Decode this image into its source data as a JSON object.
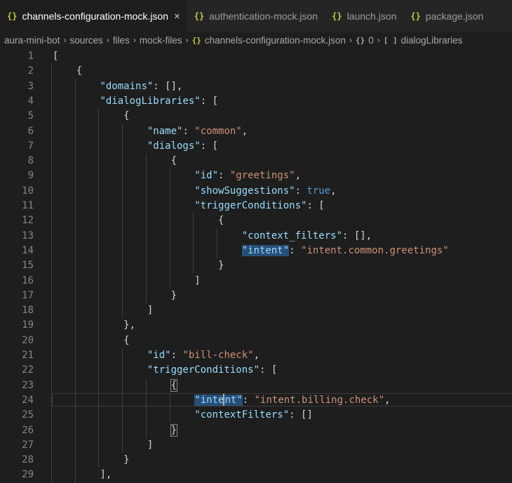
{
  "tabs": [
    {
      "label": "channels-configuration-mock.json",
      "icon": "json-braces-icon",
      "active": true,
      "close": "×"
    },
    {
      "label": "authentication-mock.json",
      "icon": "json-braces-icon",
      "active": false
    },
    {
      "label": "launch.json",
      "icon": "json-braces-icon",
      "active": false
    },
    {
      "label": "package.json",
      "icon": "json-braces-icon",
      "active": false
    }
  ],
  "breadcrumbs": [
    "aura-mini-bot",
    "sources",
    "files",
    "mock-files",
    "channels-configuration-mock.json",
    "0",
    "dialogLibraries"
  ],
  "lines": [
    {
      "n": "1",
      "ind": "",
      "t": [
        [
          "p",
          "["
        ]
      ]
    },
    {
      "n": "2",
      "ind": "    ",
      "t": [
        [
          "p",
          "{"
        ]
      ]
    },
    {
      "n": "3",
      "ind": "        ",
      "t": [
        [
          "k",
          "\"domains\""
        ],
        [
          "p",
          ": [],"
        ]
      ]
    },
    {
      "n": "4",
      "ind": "        ",
      "t": [
        [
          "k",
          "\"dialogLibraries\""
        ],
        [
          "p",
          ": ["
        ]
      ]
    },
    {
      "n": "5",
      "ind": "            ",
      "t": [
        [
          "p",
          "{"
        ]
      ]
    },
    {
      "n": "6",
      "ind": "                ",
      "t": [
        [
          "k",
          "\"name\""
        ],
        [
          "p",
          ": "
        ],
        [
          "s",
          "\"common\""
        ],
        [
          "p",
          ","
        ]
      ]
    },
    {
      "n": "7",
      "ind": "                ",
      "t": [
        [
          "k",
          "\"dialogs\""
        ],
        [
          "p",
          ": ["
        ]
      ]
    },
    {
      "n": "8",
      "ind": "                    ",
      "t": [
        [
          "p",
          "{"
        ]
      ]
    },
    {
      "n": "9",
      "ind": "                        ",
      "t": [
        [
          "k",
          "\"id\""
        ],
        [
          "p",
          ": "
        ],
        [
          "s",
          "\"greetings\""
        ],
        [
          "p",
          ","
        ]
      ]
    },
    {
      "n": "10",
      "ind": "                        ",
      "t": [
        [
          "k",
          "\"showSuggestions\""
        ],
        [
          "p",
          ": "
        ],
        [
          "b",
          "true"
        ],
        [
          "p",
          ","
        ]
      ]
    },
    {
      "n": "11",
      "ind": "                        ",
      "t": [
        [
          "k",
          "\"triggerConditions\""
        ],
        [
          "p",
          ": ["
        ]
      ]
    },
    {
      "n": "12",
      "ind": "                            ",
      "t": [
        [
          "p",
          "{"
        ]
      ]
    },
    {
      "n": "13",
      "ind": "                                ",
      "t": [
        [
          "k",
          "\"context_filters\""
        ],
        [
          "p",
          ": [],"
        ]
      ]
    },
    {
      "n": "14",
      "ind": "                                ",
      "t": [
        [
          "kh",
          "\"intent\""
        ],
        [
          "p",
          ": "
        ],
        [
          "s",
          "\"intent.common.greetings\""
        ]
      ]
    },
    {
      "n": "15",
      "ind": "                            ",
      "t": [
        [
          "p",
          "}"
        ]
      ]
    },
    {
      "n": "16",
      "ind": "                        ",
      "t": [
        [
          "p",
          "]"
        ]
      ]
    },
    {
      "n": "17",
      "ind": "                    ",
      "t": [
        [
          "p",
          "}"
        ]
      ]
    },
    {
      "n": "18",
      "ind": "                ",
      "t": [
        [
          "p",
          "]"
        ]
      ]
    },
    {
      "n": "19",
      "ind": "            ",
      "t": [
        [
          "p",
          "},"
        ]
      ]
    },
    {
      "n": "20",
      "ind": "            ",
      "t": [
        [
          "p",
          "{"
        ]
      ]
    },
    {
      "n": "21",
      "ind": "                ",
      "t": [
        [
          "k",
          "\"id\""
        ],
        [
          "p",
          ": "
        ],
        [
          "s",
          "\"bill-check\""
        ],
        [
          "p",
          ","
        ]
      ]
    },
    {
      "n": "22",
      "ind": "                ",
      "t": [
        [
          "k",
          "\"triggerConditions\""
        ],
        [
          "p",
          ": ["
        ]
      ]
    },
    {
      "n": "23",
      "ind": "                    ",
      "t": [
        [
          "pm",
          "{"
        ]
      ]
    },
    {
      "n": "24",
      "ind": "                        ",
      "t": [
        [
          "kh",
          "\"inte"
        ],
        [
          "c",
          ""
        ],
        [
          "kh",
          "nt\""
        ],
        [
          "p",
          ": "
        ],
        [
          "s",
          "\"intent.billing.check\""
        ],
        [
          "p",
          ","
        ]
      ]
    },
    {
      "n": "25",
      "ind": "                        ",
      "t": [
        [
          "k",
          "\"contextFilters\""
        ],
        [
          "p",
          ": []"
        ]
      ]
    },
    {
      "n": "26",
      "ind": "                    ",
      "t": [
        [
          "pm",
          "}"
        ]
      ]
    },
    {
      "n": "27",
      "ind": "                ",
      "t": [
        [
          "p",
          "]"
        ]
      ]
    },
    {
      "n": "28",
      "ind": "            ",
      "t": [
        [
          "p",
          "}"
        ]
      ]
    },
    {
      "n": "29",
      "ind": "        ",
      "t": [
        [
          "p",
          "],"
        ]
      ]
    }
  ]
}
